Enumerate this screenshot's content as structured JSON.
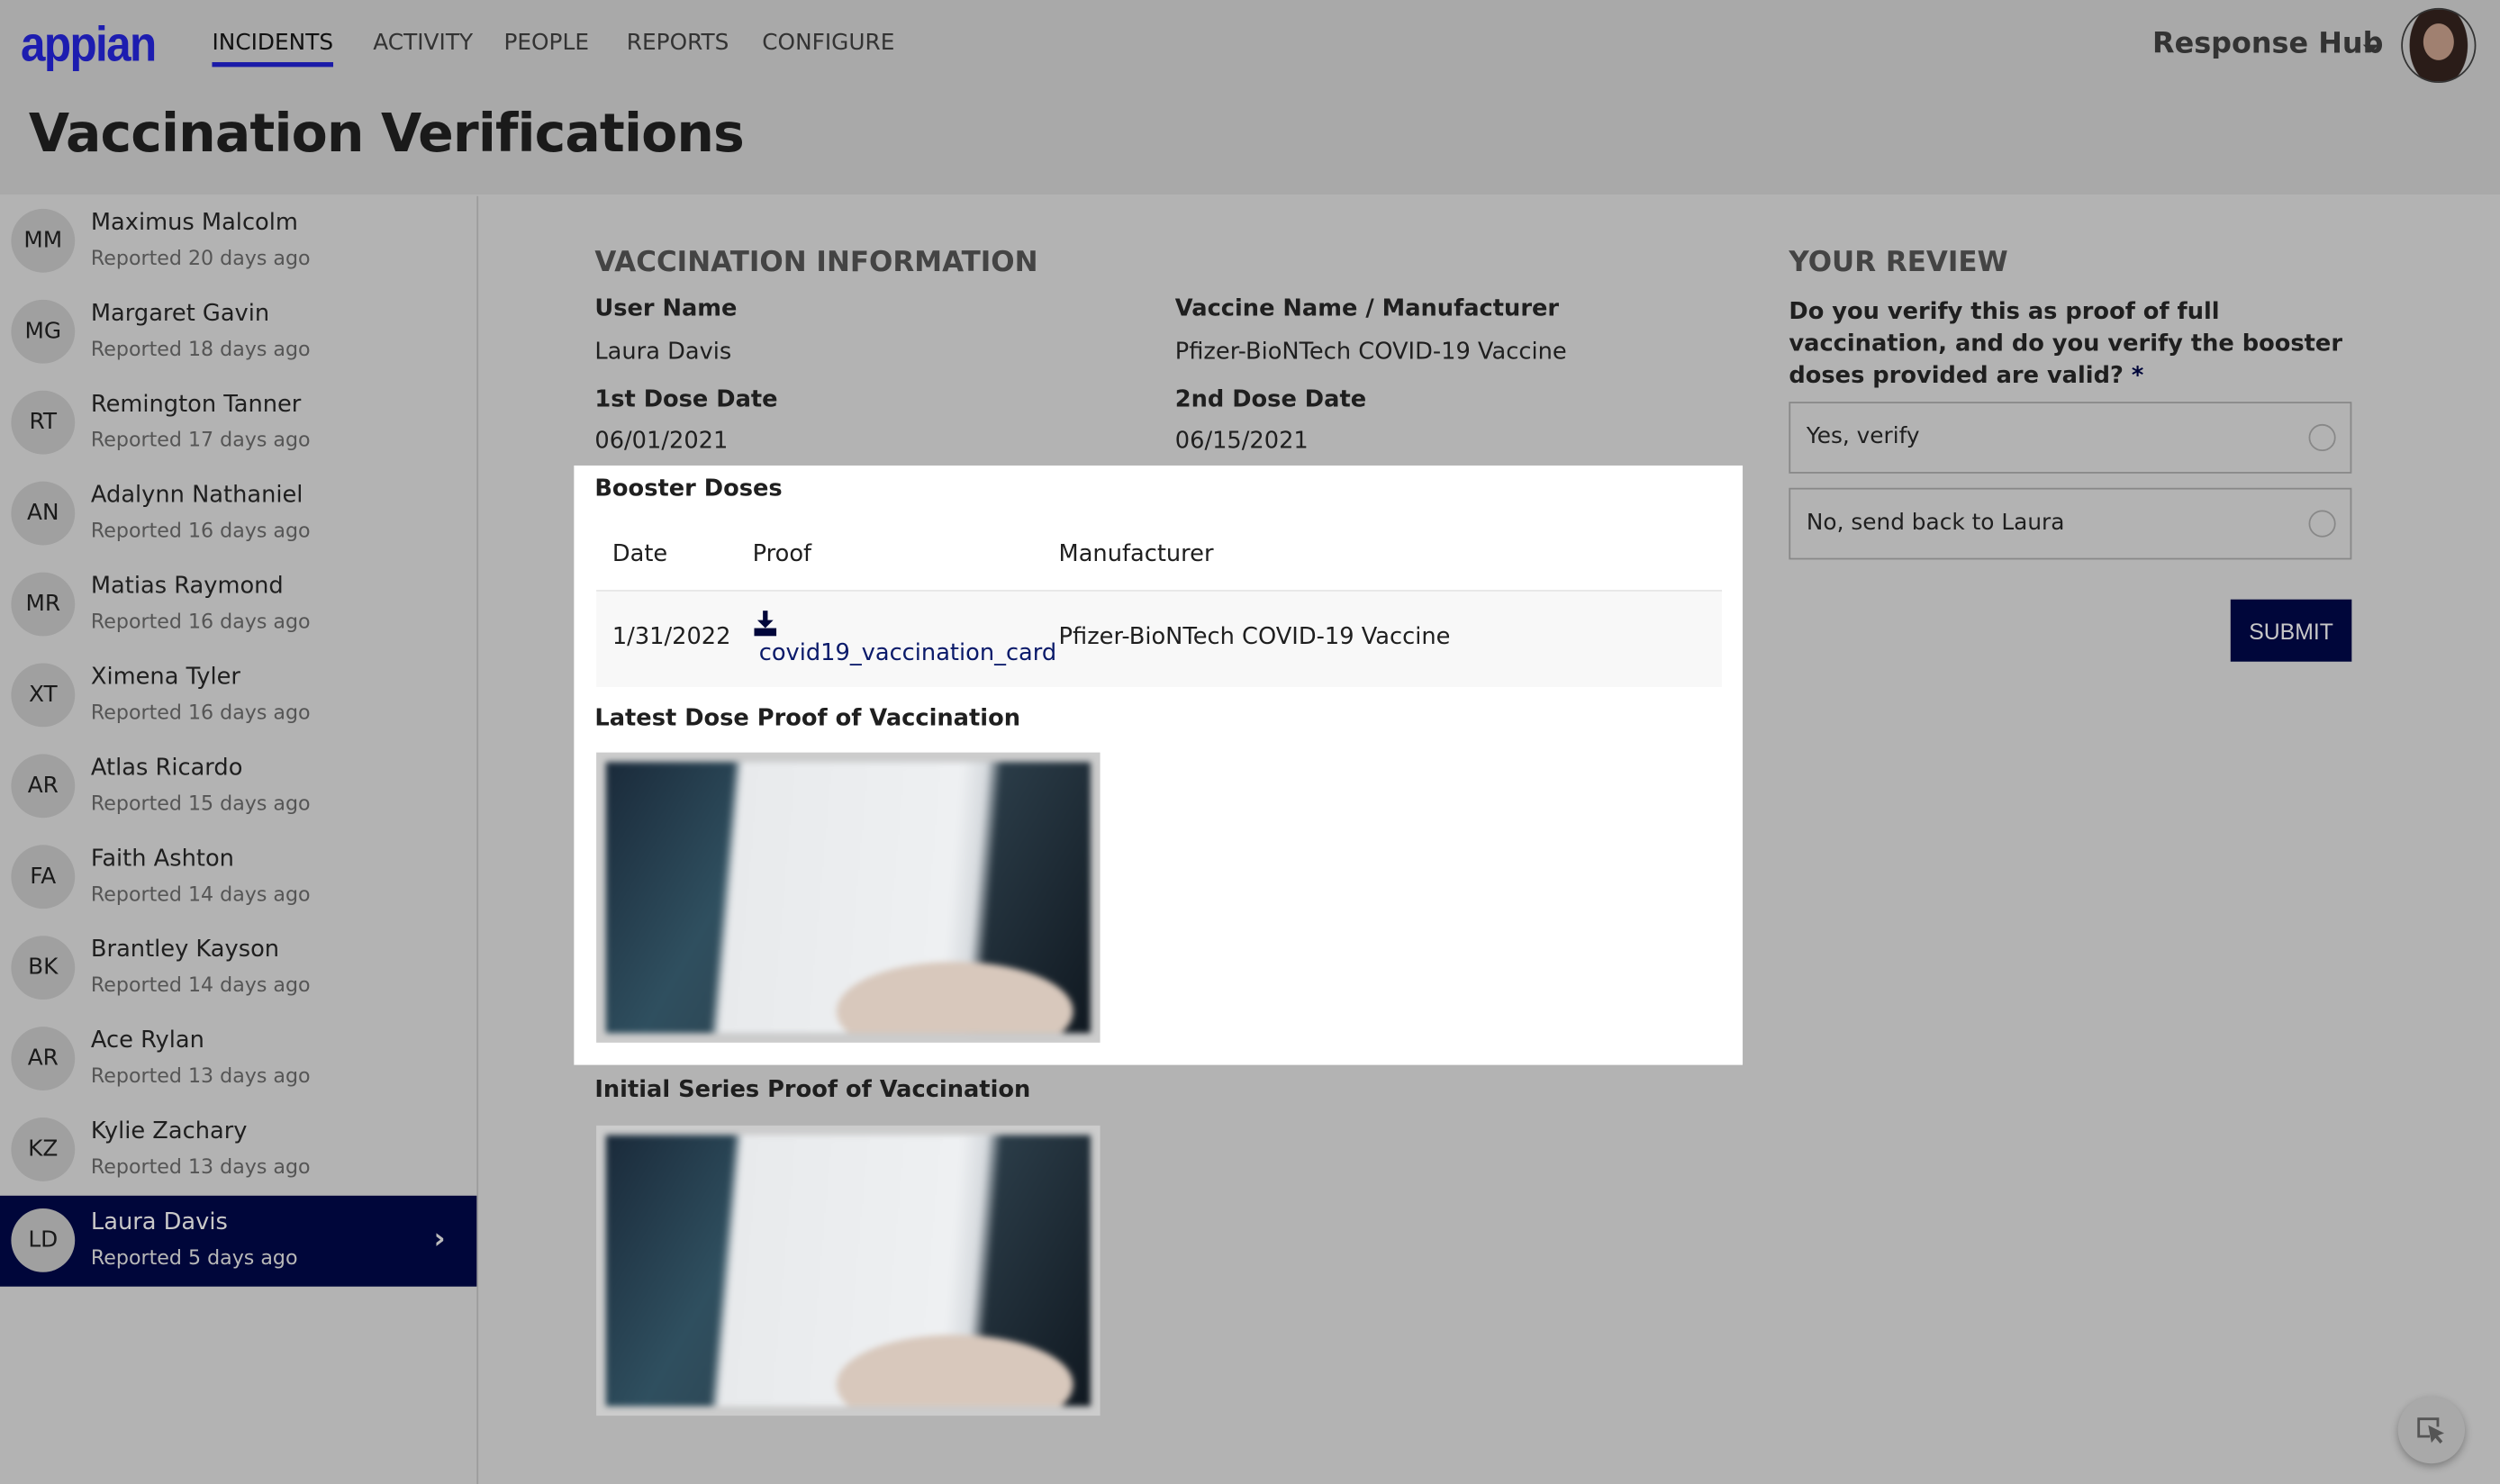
{
  "header": {
    "logo": "appian",
    "nav": [
      {
        "label": "INCIDENTS",
        "active": true
      },
      {
        "label": "ACTIVITY"
      },
      {
        "label": "PEOPLE"
      },
      {
        "label": "REPORTS"
      },
      {
        "label": "CONFIGURE"
      }
    ],
    "site_menu": "Response Hub",
    "accent": "#1a1aa8"
  },
  "page_title": "Vaccination Verifications",
  "sidebar": {
    "items": [
      {
        "initials": "MM",
        "name": "Maximus Malcolm",
        "reported": "Reported 20 days ago"
      },
      {
        "initials": "MG",
        "name": "Margaret Gavin",
        "reported": "Reported 18 days ago"
      },
      {
        "initials": "RT",
        "name": "Remington Tanner",
        "reported": "Reported 17 days ago"
      },
      {
        "initials": "AN",
        "name": "Adalynn Nathaniel",
        "reported": "Reported 16 days ago"
      },
      {
        "initials": "MR",
        "name": "Matias Raymond",
        "reported": "Reported 16 days ago"
      },
      {
        "initials": "XT",
        "name": "Ximena Tyler",
        "reported": "Reported 16 days ago"
      },
      {
        "initials": "AR",
        "name": "Atlas Ricardo",
        "reported": "Reported 15 days ago"
      },
      {
        "initials": "FA",
        "name": "Faith Ashton",
        "reported": "Reported 14 days ago"
      },
      {
        "initials": "BK",
        "name": "Brantley Kayson",
        "reported": "Reported 14 days ago"
      },
      {
        "initials": "AR",
        "name": "Ace Rylan",
        "reported": "Reported 13 days ago"
      },
      {
        "initials": "KZ",
        "name": "Kylie Zachary",
        "reported": "Reported 13 days ago"
      },
      {
        "initials": "LD",
        "name": "Laura Davis",
        "reported": "Reported 5 days ago",
        "selected": true
      }
    ],
    "selected_color": "#00063a"
  },
  "info": {
    "title": "VACCINATION INFORMATION",
    "user_name_label": "User Name",
    "user_name": "Laura Davis",
    "vaccine_label": "Vaccine Name / Manufacturer",
    "vaccine": "Pfizer-BioNTech COVID-19 Vaccine",
    "dose1_label": "1st Dose Date",
    "dose1": "06/01/2021",
    "dose2_label": "2nd Dose Date",
    "dose2": "06/15/2021"
  },
  "booster": {
    "title": "Booster Doses",
    "columns": [
      "Date",
      "Proof",
      "Manufacturer"
    ],
    "rows": [
      {
        "date": "1/31/2022",
        "proof": "covid19_vaccination_card",
        "manufacturer": "Pfizer-BioNTech COVID-19 Vaccine"
      }
    ]
  },
  "latest_proof_label": "Latest Dose Proof of Vaccination",
  "initial_proof_label": "Initial Series Proof of Vaccination",
  "review": {
    "title": "YOUR REVIEW",
    "question": "Do you verify this as proof of full vaccination, and do you verify the booster doses provided are valid?",
    "required_mark": "*",
    "options": [
      "Yes, verify",
      "No, send back to Laura"
    ],
    "submit": "SUBMIT"
  }
}
